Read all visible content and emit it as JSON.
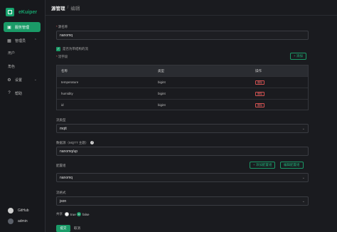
{
  "app": {
    "name": "eKuiper"
  },
  "sidebar": {
    "items": [
      {
        "label": "服务管理",
        "icon": "cube-icon"
      },
      {
        "label": "管理员",
        "icon": "grid-icon"
      },
      {
        "label": "用户"
      },
      {
        "label": "角色"
      },
      {
        "label": "设置",
        "icon": "gear-icon"
      },
      {
        "label": "帮助",
        "icon": "help-icon"
      }
    ],
    "footer": [
      {
        "label": "GitHub",
        "icon": "github-icon"
      },
      {
        "label": "admin",
        "icon": "avatar-icon"
      }
    ]
  },
  "breadcrumb": {
    "parent": "源管理",
    "separator": "/",
    "current": "编辑"
  },
  "form": {
    "name_label": "源名称",
    "name_value": "nanomq",
    "schemaless_label": "是否为带结构的流",
    "fields_label": "流字段",
    "add_label": "+ 添加",
    "table": {
      "headers": [
        "名称",
        "类型",
        "操作"
      ],
      "rows": [
        {
          "name": "temperature",
          "type": "bigint",
          "action": "删除"
        },
        {
          "name": "humidity",
          "type": "bigint",
          "action": "删除"
        },
        {
          "name": "id",
          "type": "bigint",
          "action": "删除"
        }
      ]
    },
    "type_label": "流类型",
    "type_value": "mqtt",
    "datasource_label": "数据源（MQTT 主题）",
    "datasource_value": "nanomq/up",
    "config_label": "配置组",
    "add_config_label": "+ 添加配置组",
    "edit_config_label": "编辑配置组",
    "config_value": "nanomq",
    "format_label": "流格式",
    "format_value": "json",
    "shared_label": "共享",
    "shared_true": "true",
    "shared_false": "false",
    "submit_label": "提交",
    "cancel_label": "取消"
  },
  "colors": {
    "accent": "#1a9a67",
    "danger": "#d24f4f"
  }
}
